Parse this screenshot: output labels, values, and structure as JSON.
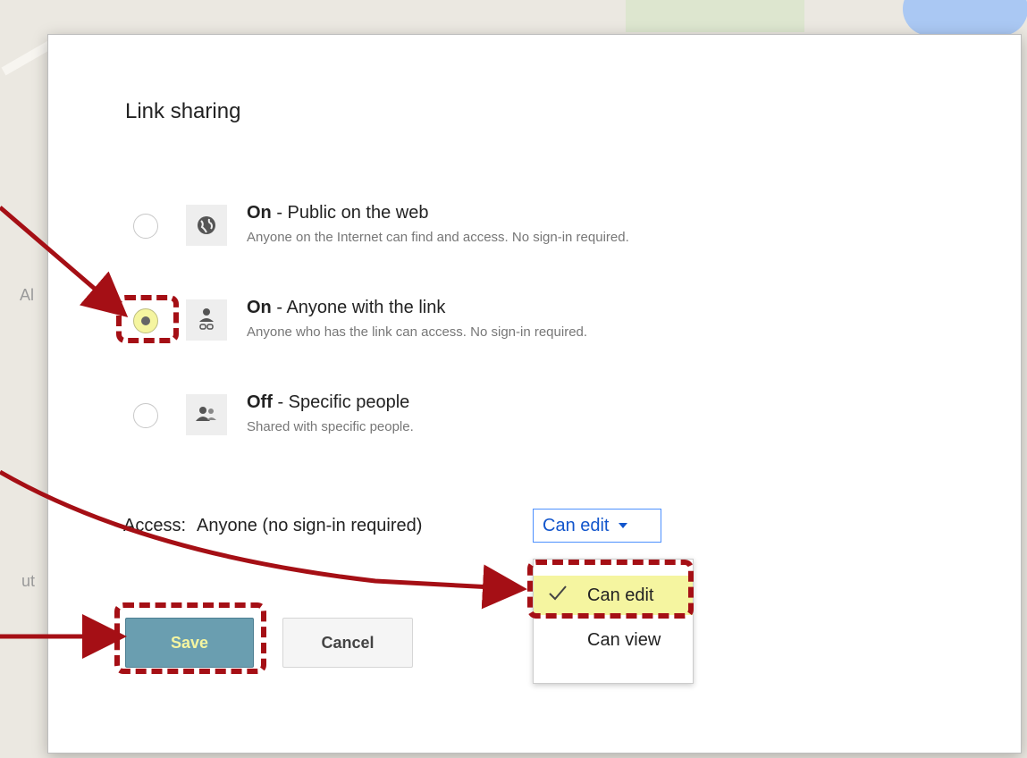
{
  "dialog": {
    "title": "Link sharing",
    "options": [
      {
        "state": "On",
        "title": " - Public on the web",
        "desc": "Anyone on the Internet can find and access. No sign-in required.",
        "icon": "globe-icon",
        "checked": false
      },
      {
        "state": "On",
        "title": " - Anyone with the link",
        "desc": "Anyone who has the link can access. No sign-in required.",
        "icon": "person-link-icon",
        "checked": true
      },
      {
        "state": "Off",
        "title": " - Specific people",
        "desc": "Shared with specific people.",
        "icon": "people-icon",
        "checked": false
      }
    ],
    "access": {
      "label": "Access:",
      "value": "Anyone (no sign-in required)",
      "select_value": "Can edit",
      "menu": [
        {
          "label": "Can edit",
          "selected": true
        },
        {
          "label": "Can view",
          "selected": false
        }
      ]
    },
    "buttons": {
      "save": "Save",
      "cancel": "Cancel"
    }
  },
  "map": {
    "labels": [
      "Al",
      "ut"
    ]
  },
  "colors": {
    "annotation": "#a50f15",
    "highlight": "#f5f5a0",
    "link_blue": "#1155cc"
  }
}
